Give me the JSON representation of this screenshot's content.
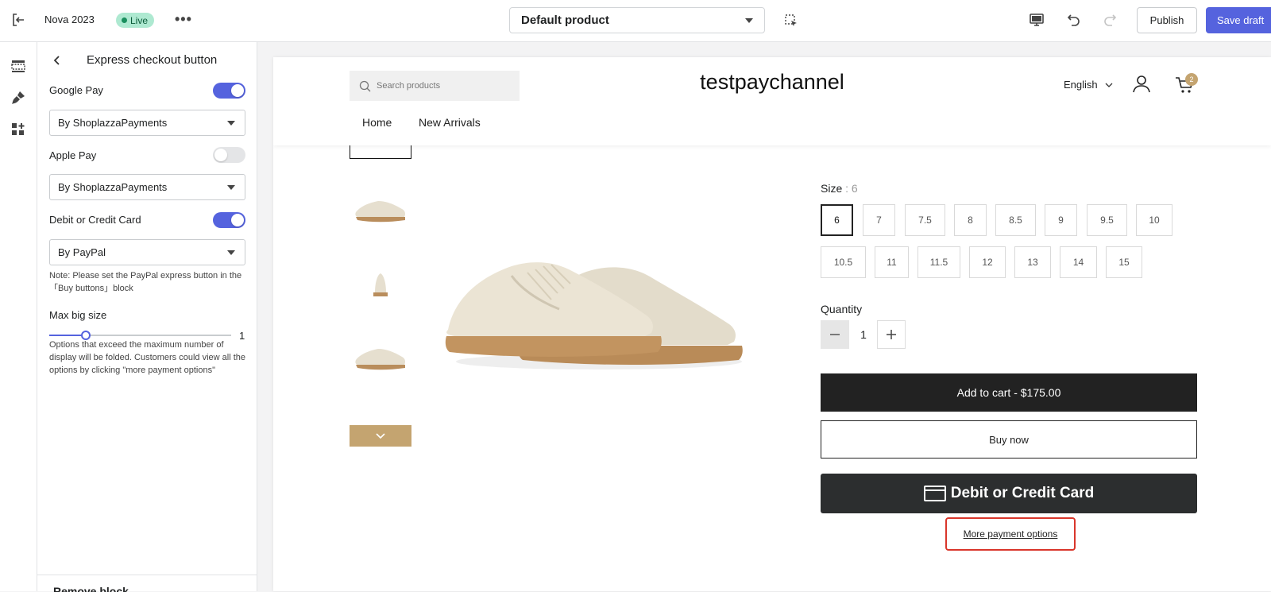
{
  "topbar": {
    "store_name": "Nova 2023",
    "live_badge": "Live",
    "more_label": "•••",
    "product_select": "Default product",
    "publish_label": "Publish",
    "save_label": "Save draft"
  },
  "panel": {
    "title": "Express checkout button",
    "options": [
      {
        "label": "Google Pay",
        "enabled": true,
        "provider": "By ShoplazzaPayments"
      },
      {
        "label": "Apple Pay",
        "enabled": false,
        "provider": "By ShoplazzaPayments"
      },
      {
        "label": "Debit or Credit Card",
        "enabled": true,
        "provider": "By PayPal"
      }
    ],
    "note": "Note: Please set the PayPal express button in the「Buy buttons」block",
    "max_size_label": "Max big size",
    "max_size_value": "1",
    "max_size_level": 0.17,
    "max_size_help": "Options that exceed the maximum number of display will be folded. Customers could view all the options by clicking \"more payment options\"",
    "footer_label": "Remove block"
  },
  "store": {
    "search_placeholder": "Search products",
    "logo": "testpaychannel",
    "language": "English",
    "cart_count": "2",
    "nav": [
      "Home",
      "New Arrivals"
    ]
  },
  "product": {
    "size_label": "Size",
    "size_selected": ": 6",
    "sizes_row1": [
      "6",
      "7",
      "7.5",
      "8",
      "8.5",
      "9",
      "9.5",
      "10"
    ],
    "sizes_row2": [
      "10.5",
      "11",
      "11.5",
      "12",
      "13",
      "14",
      "15"
    ],
    "quantity_label": "Quantity",
    "quantity_value": "1",
    "add_to_cart": "Add to cart - $175.00",
    "buy_now": "Buy now",
    "card_button": "Debit or Credit Card",
    "more_payment": "More payment options"
  },
  "colors": {
    "accent": "#5563de",
    "live_badge_bg": "#aee9d1",
    "brand_tan": "#c4a470",
    "highlight": "#d9362b"
  }
}
